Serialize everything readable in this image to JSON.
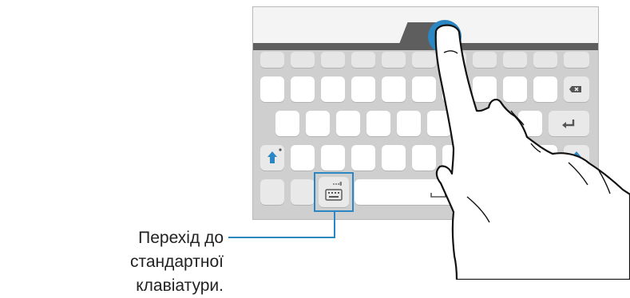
{
  "callout": {
    "line1": "Перехід до стандартної",
    "line2": "клавіатури."
  },
  "colors": {
    "accent": "#2b86c4",
    "keyboard_bar": "#5e5e5e",
    "keyboard_body": "#cfcfcf",
    "key": "#ffffff"
  },
  "icons": {
    "backspace": "backspace-icon",
    "enter": "enter-icon",
    "shift": "shift-arrow-icon",
    "keyboard": "keyboard-icon",
    "hand": "hand-swipe-icon"
  }
}
